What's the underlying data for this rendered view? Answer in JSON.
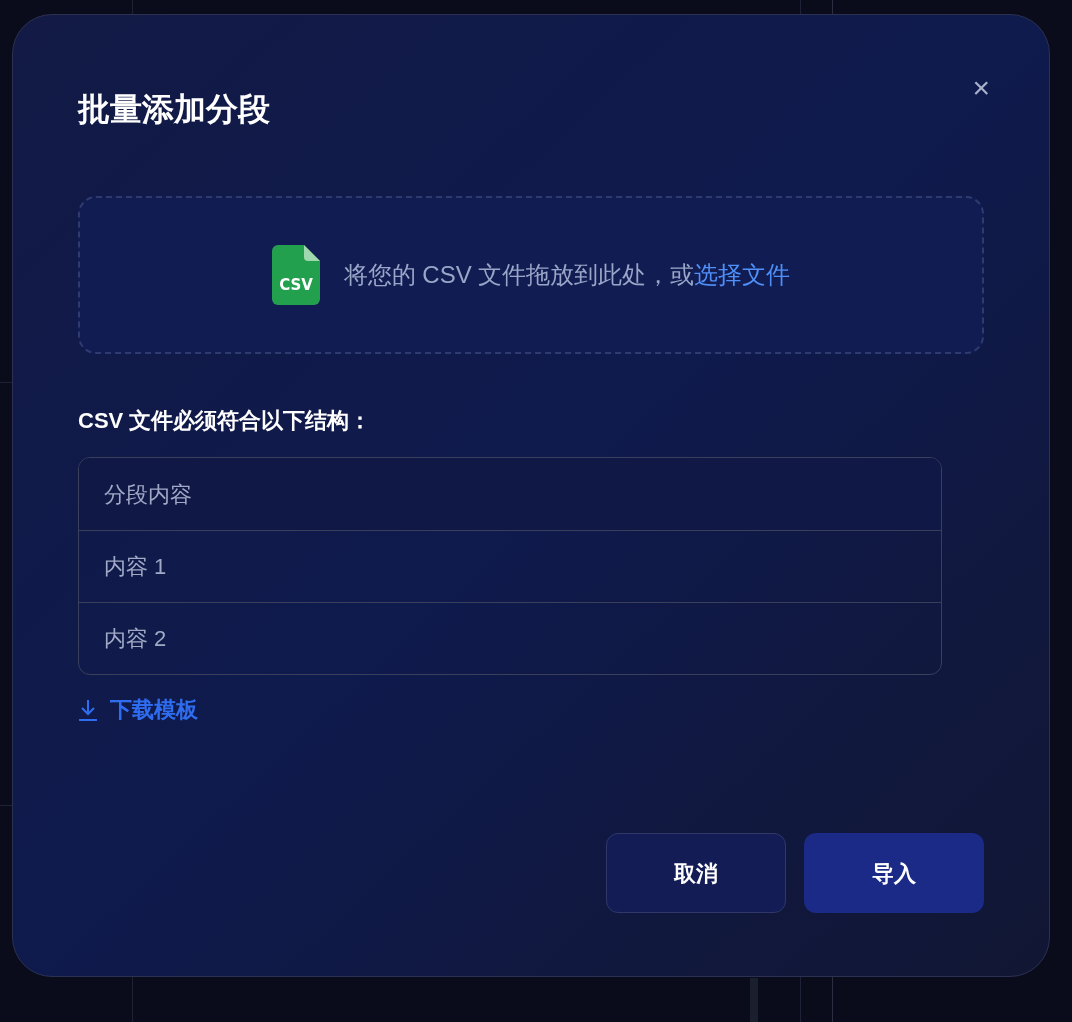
{
  "dialog": {
    "title": "批量添加分段",
    "close_icon": "×"
  },
  "dropzone": {
    "file_badge": "CSV",
    "text": "将您的 CSV 文件拖放到此处，或",
    "link": "选择文件"
  },
  "structure": {
    "heading": "CSV 文件必须符合以下结构：",
    "rows": [
      {
        "kind": "header",
        "text": "分段内容"
      },
      {
        "kind": "row",
        "text": "内容 1"
      },
      {
        "kind": "row",
        "text": "内容 2"
      }
    ]
  },
  "download_link": "下载模板",
  "buttons": [
    {
      "kind": "secondary",
      "label": "取消"
    },
    {
      "kind": "primary",
      "label": "导入"
    }
  ]
}
